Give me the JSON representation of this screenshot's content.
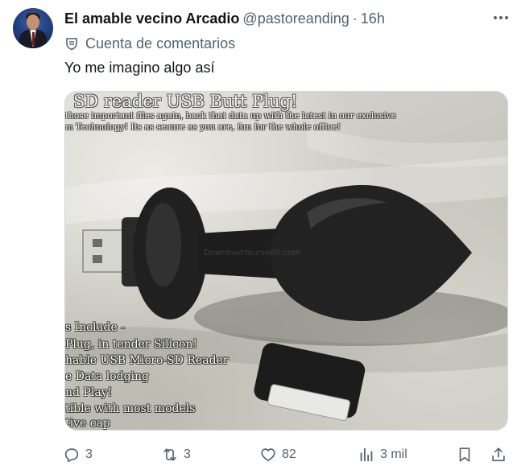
{
  "author": {
    "display_name": "El amable vecino Arcadio",
    "handle": "@pastoreanding",
    "separator": "·",
    "time": "16h",
    "account_label": "Cuenta de comentarios"
  },
  "tweet": {
    "text": "Yo me imagino algo así"
  },
  "media": {
    "title": "SD reader USB Butt Plug!",
    "intro_lines": [
      "those important files again, back that data up with the latest in our exclusive",
      "m Technology! Its as secure as you are, fun for the whole office!"
    ],
    "watermark": "DownloadYourselfIt.com",
    "features": [
      "s Include -",
      "Plug, in tender Silicon!",
      "hable USB Micro-SD Reader",
      "e Data lodging",
      "nd Play!",
      "tible with most models",
      "tive cap"
    ]
  },
  "actions": {
    "replies": "3",
    "reposts": "3",
    "likes": "82",
    "views": "3 mil"
  },
  "icons": {
    "reply": "reply-icon",
    "repost": "repost-icon",
    "like": "heart-icon",
    "views": "views-icon",
    "bookmark": "bookmark-icon",
    "share": "share-icon",
    "more": "more-options-icon",
    "badge": "community-notes-badge-icon"
  },
  "colors": {
    "text_primary": "#0f1419",
    "text_secondary": "#536471"
  }
}
